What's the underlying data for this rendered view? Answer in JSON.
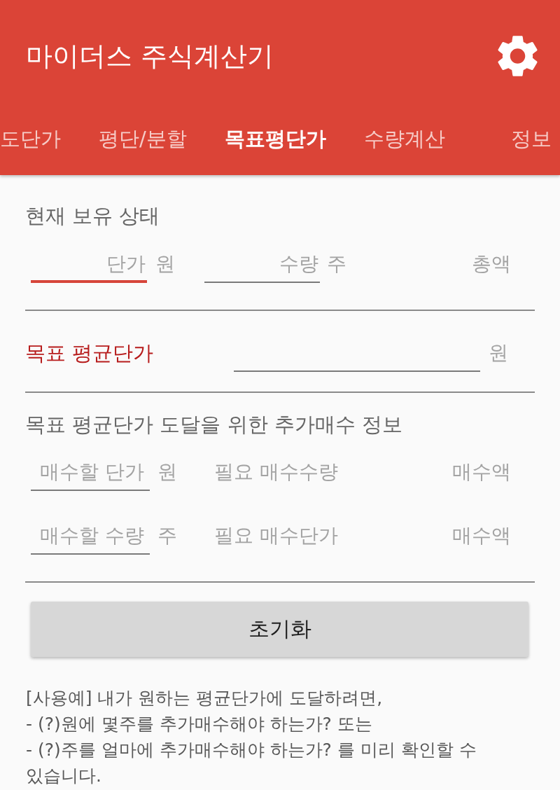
{
  "app_bar": {
    "title": "마이더스 주식계산기"
  },
  "tabs": [
    {
      "label": "도단가",
      "selected": false
    },
    {
      "label": "평단/분할",
      "selected": false
    },
    {
      "label": "목표평단가",
      "selected": true
    },
    {
      "label": "수량계산",
      "selected": false
    },
    {
      "label": "정보",
      "selected": false
    }
  ],
  "current_holding": {
    "title": "현재 보유 상태",
    "fields": [
      {
        "placeholder": "단가",
        "unit": "원",
        "focused": true
      },
      {
        "placeholder": "수량",
        "unit": "주",
        "focused": false
      }
    ],
    "total_label": "총액"
  },
  "target_average": {
    "label": "목표 평균단가",
    "unit": "원",
    "focused": false
  },
  "additional_buy": {
    "title": "목표 평균단가 도달을 위한 추가매수 정보",
    "rows": [
      {
        "placeholder": "매수할 단가",
        "unit": "원",
        "focused": false,
        "result_label": "필요 매수수량",
        "amount_label": "매수액"
      },
      {
        "placeholder": "매수할 수량",
        "unit": "주",
        "focused": false,
        "result_label": "필요 매수단가",
        "amount_label": "매수액"
      }
    ]
  },
  "reset_button": {
    "label": "초기화"
  },
  "usage_note": "[사용예] 내가 원하는 평균단가에 도달하려면,\n- (?)원에 몇주를 추가매수해야 하는가? 또는\n- (?)주를 얼마에 추가매수해야 하는가? 를 미리 확인할 수 있습니다."
}
